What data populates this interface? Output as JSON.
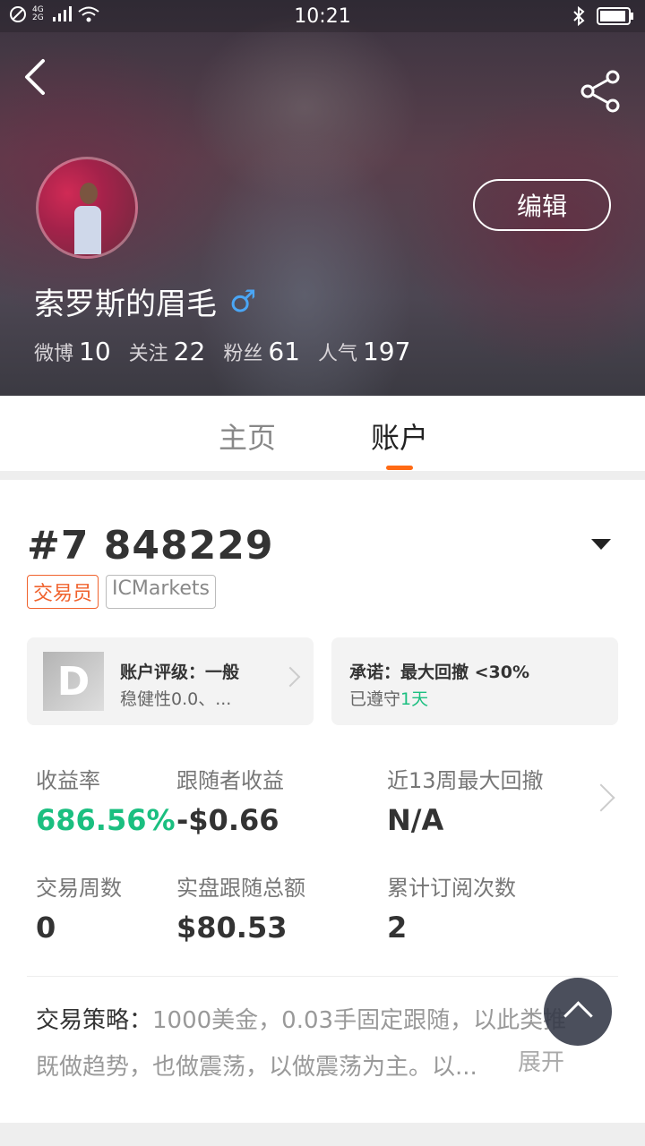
{
  "status_bar": {
    "network": "4G 2G",
    "time": "10:21"
  },
  "profile": {
    "edit_label": "编辑",
    "username": "索罗斯的眉毛",
    "gender_symbol": "♂",
    "stats": [
      {
        "label": "微博",
        "value": "10"
      },
      {
        "label": "关注",
        "value": "22"
      },
      {
        "label": "粉丝",
        "value": "61"
      },
      {
        "label": "人气",
        "value": "197"
      }
    ]
  },
  "tabs": [
    {
      "label": "主页",
      "active": false
    },
    {
      "label": "账户",
      "active": true
    }
  ],
  "account": {
    "number": "#7 848229",
    "tags": [
      "交易员",
      "ICMarkets"
    ],
    "rating_badge": "D",
    "rating_title": "账户评级：一般",
    "rating_sub": "稳健性0.0、...",
    "promise_title": "承诺：最大回撤 <30%",
    "promise_sub_prefix": "已遵守",
    "promise_sub_value": "1天"
  },
  "metrics": [
    {
      "label": "收益率",
      "value": "686.56%"
    },
    {
      "label": "跟随者收益",
      "value": "-$0.66"
    },
    {
      "label": "近13周最大回撤",
      "value": "N/A"
    },
    {
      "label": "交易周数",
      "value": "0"
    },
    {
      "label": "实盘跟随总额",
      "value": "$80.53"
    },
    {
      "label": "累计订阅次数",
      "value": "2"
    }
  ],
  "strategy": {
    "label": "交易策略：",
    "text_line1": "1000美金，0.03手固定跟随，以此类推",
    "text_line2": "既做趋势，也做震荡，以做震荡为主。以...",
    "expand_label": "展开"
  },
  "colors": {
    "accent_orange": "#ff6a14",
    "positive_green": "#1bbf80",
    "gender_blue": "#4aa6f5"
  }
}
